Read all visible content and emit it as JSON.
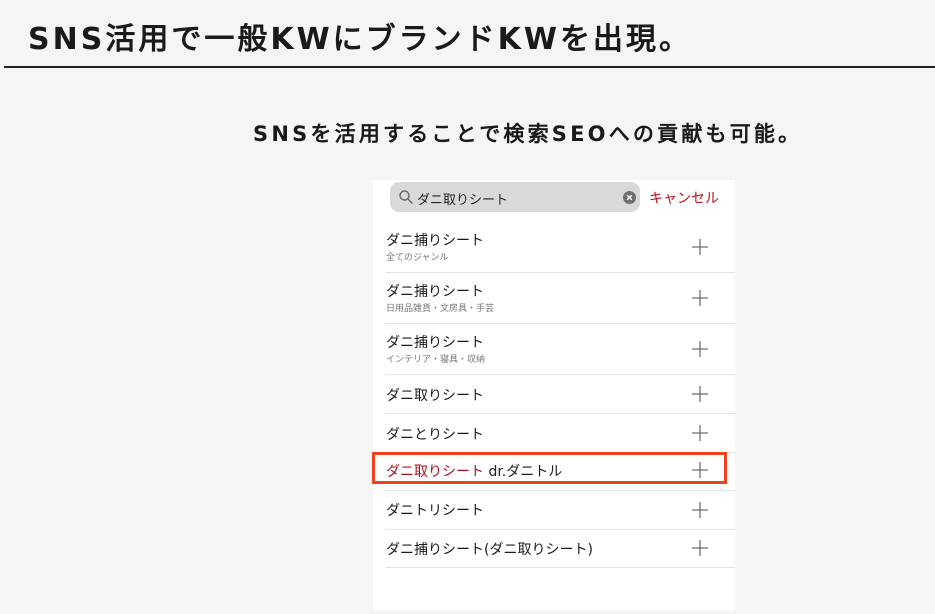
{
  "slide": {
    "title": "SNS活用で一般KWにブランドKWを出現。",
    "subtitle": "SNSを活用することで検索SEOへの貢献も可能。"
  },
  "search": {
    "query": "ダニ取りシート",
    "cancel_label": "キャンセル"
  },
  "suggestions": [
    {
      "label": "ダニ捕りシート",
      "category": "全てのジャンル"
    },
    {
      "label": "ダニ捕りシート",
      "category": "日用品雑貨・文房具・手芸"
    },
    {
      "label": "ダニ捕りシート",
      "category": "インテリア・寝具・収納"
    },
    {
      "label": "ダニ取りシート"
    },
    {
      "label": "ダニとりシート"
    },
    {
      "label_highlight": "ダニ取りシート",
      "label_rest": " dr.ダニトル",
      "highlighted": true
    },
    {
      "label": "ダニトリシート"
    },
    {
      "label": "ダニ捕りシート(ダニ取りシート)"
    }
  ],
  "colors": {
    "accent": "#c0101a",
    "highlight_border": "#f0401e"
  },
  "icons": {
    "search": "search-icon",
    "clear": "clear-icon",
    "add": "plus-icon"
  }
}
